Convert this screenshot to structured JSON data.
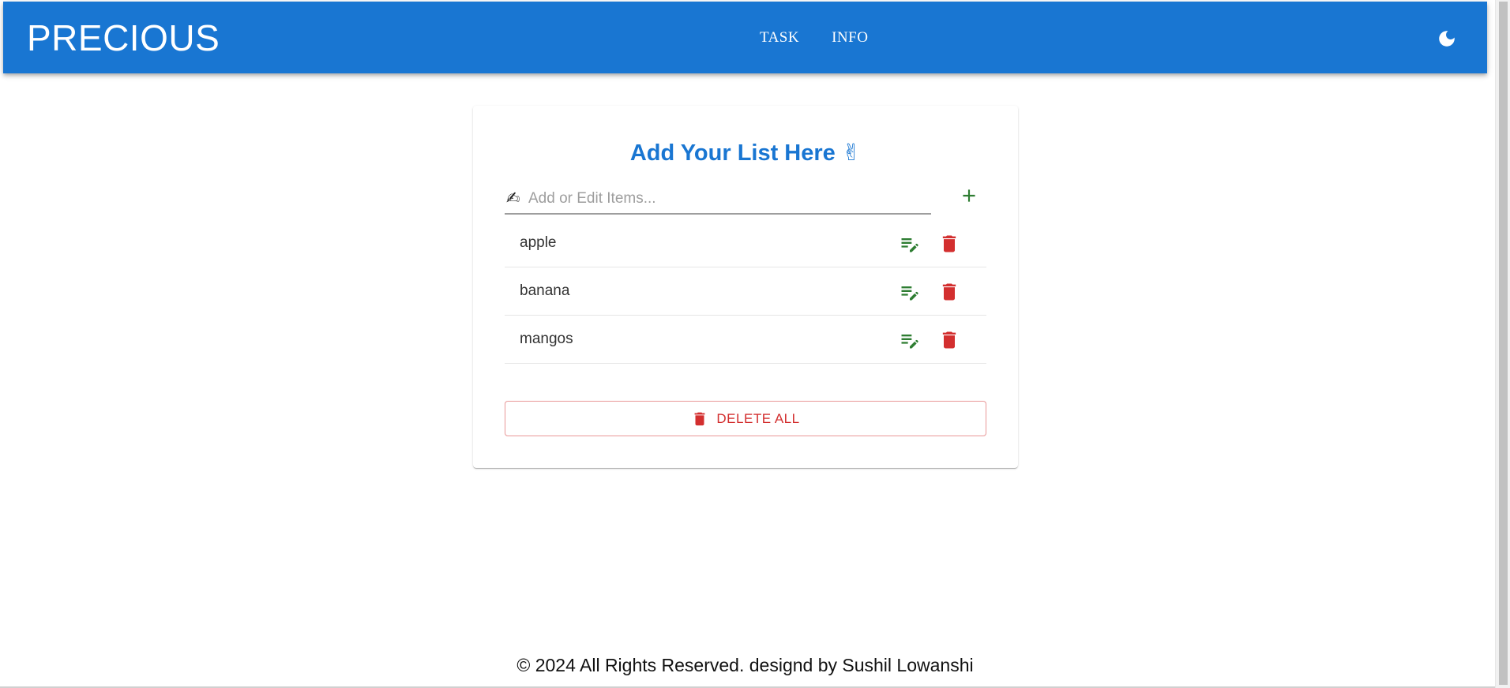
{
  "header": {
    "brand": "PRECIOUS",
    "nav": [
      {
        "label": "TASK"
      },
      {
        "label": "INFO"
      }
    ],
    "theme_icon": "moon-icon"
  },
  "card": {
    "title": "Add Your List Here ✌",
    "input": {
      "icon": "✍",
      "placeholder": "Add or Edit Items...",
      "value": ""
    },
    "add_icon": "plus-icon",
    "items": [
      {
        "text": "apple"
      },
      {
        "text": "banana"
      },
      {
        "text": "mangos"
      }
    ],
    "delete_all_label": "DELETE ALL"
  },
  "footer": {
    "text": "© 2024 All Rights Reserved. designd by Sushil Lowanshi"
  },
  "colors": {
    "primary": "#1976d2",
    "success": "#2e7d32",
    "error": "#d32f2f"
  }
}
